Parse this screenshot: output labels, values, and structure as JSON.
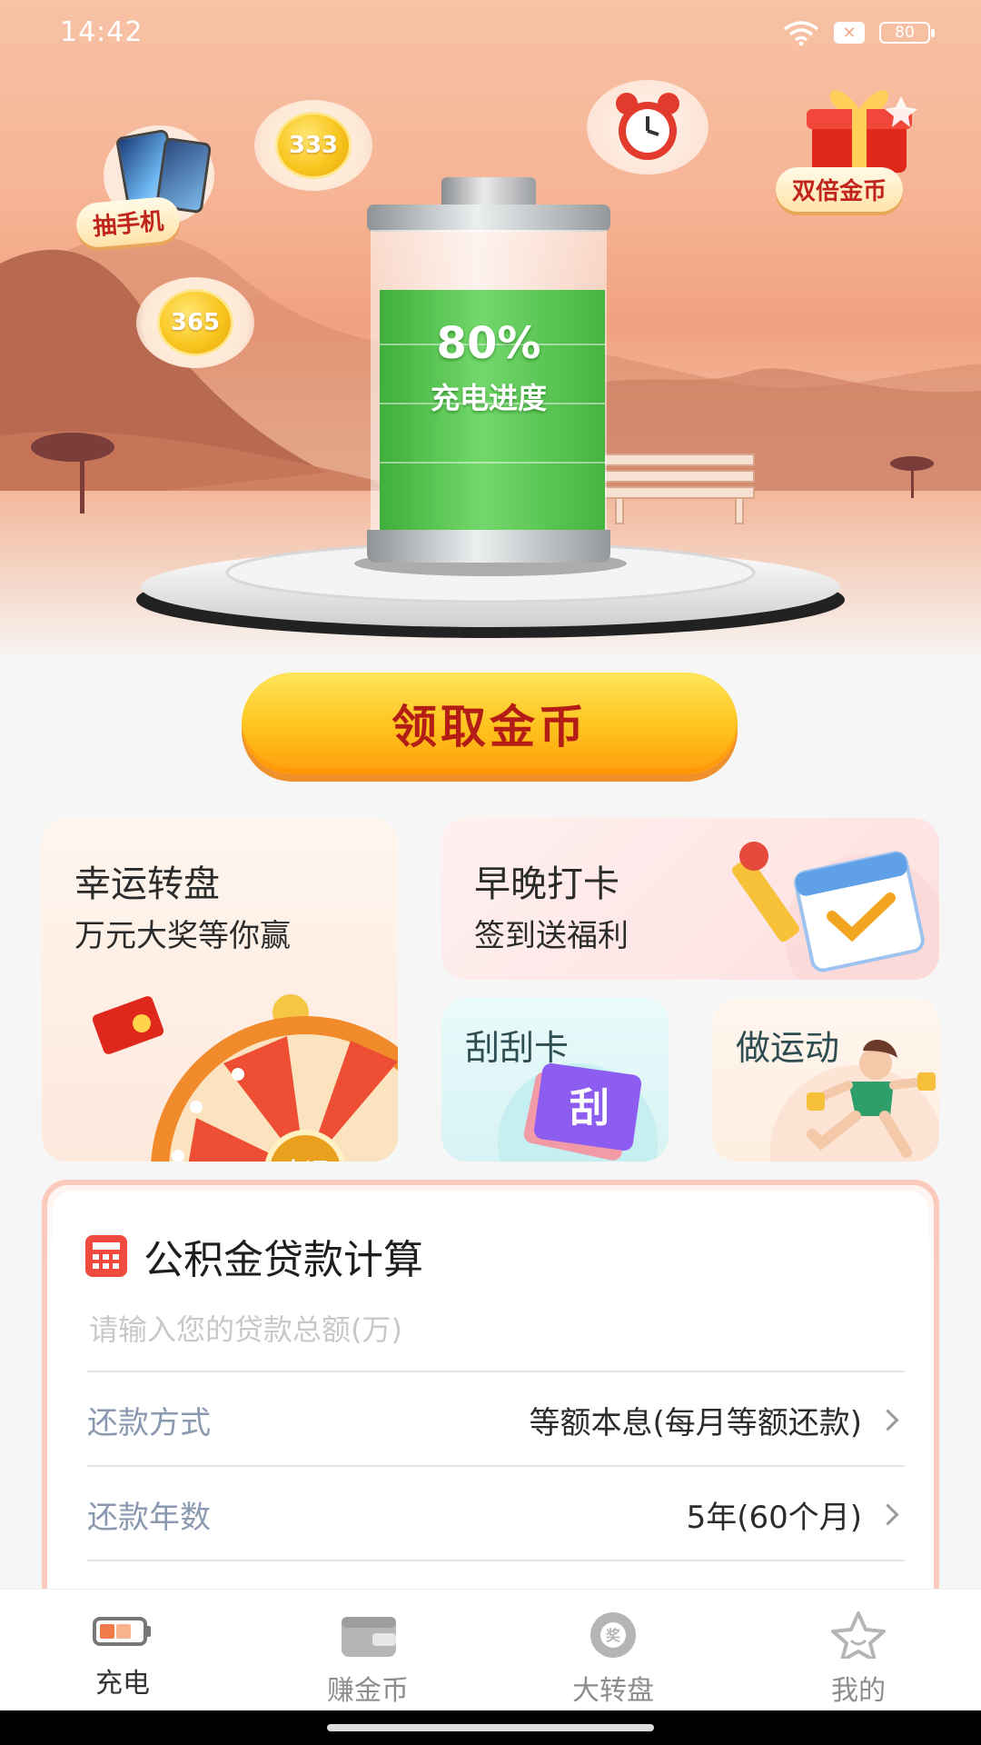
{
  "status_bar": {
    "time": "14:42",
    "battery": "80"
  },
  "hero": {
    "lottery_phone_label": "抽手机",
    "coin_1": "333",
    "coin_2": "365",
    "double_coins_label": "双倍金币",
    "battery_percent": "80%",
    "battery_label": "充电进度",
    "charge_level": 0.8
  },
  "claim_button": "领取金币",
  "cards": {
    "lucky_wheel": {
      "title": "幸运转盘",
      "subtitle": "万元大奖等你赢",
      "badge": "幸运"
    },
    "checkin": {
      "title": "早晚打卡",
      "subtitle": "签到送福利"
    },
    "scratch": {
      "title": "刮刮卡",
      "badge": "刮"
    },
    "sport": {
      "title": "做运动"
    }
  },
  "calculator": {
    "title": "公积金贷款计算",
    "amount_placeholder": "请输入您的贷款总额(万)",
    "rows": [
      {
        "label": "还款方式",
        "value": "等额本息(每月等额还款)"
      },
      {
        "label": "还款年数",
        "value": "5年(60个月)"
      }
    ]
  },
  "nav": [
    {
      "label": "充电",
      "icon": "battery-icon",
      "active": true
    },
    {
      "label": "赚金币",
      "icon": "wallet-icon",
      "active": false
    },
    {
      "label": "大转盘",
      "icon": "prize-wheel-icon",
      "active": false
    },
    {
      "label": "我的",
      "icon": "star-icon",
      "active": false
    }
  ],
  "colors": {
    "accent": "#ffc21c",
    "claim_text": "#b31d16",
    "battery_green": "#5cc956",
    "calc_border": "#fbcabc"
  }
}
